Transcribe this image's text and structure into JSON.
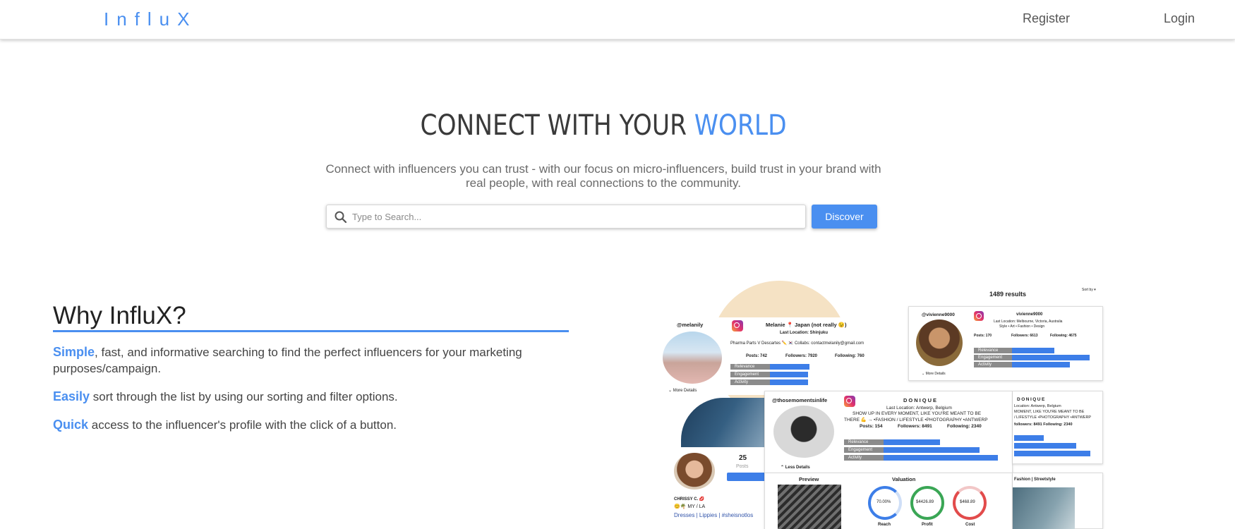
{
  "navbar": {
    "logo": "InfluX",
    "register": "Register",
    "login": "Login"
  },
  "hero": {
    "title_main": "CONNECT WITH YOUR ",
    "title_accent": "WORLD",
    "subtitle": "Connect with influencers you can trust - with our focus on micro-influencers, build trust in your brand with real people, with real connections to the community.",
    "search_placeholder": "Type to Search...",
    "discover": "Discover"
  },
  "why": {
    "title": "Why InfluX?",
    "p1_keyword": "Simple",
    "p1_text": ", fast, and informative searching to find the perfect influencers for your marketing purposes/campaign.",
    "p2_keyword": "Easily",
    "p2_text": " sort through the list by using our sorting and filter options.",
    "p3_keyword": "Quick",
    "p3_text": " access to the influencer's profile with the click of a button."
  },
  "collage": {
    "results": "1489 results",
    "sortby": "Sort by ▾",
    "card1": {
      "handle": "@melanily",
      "name": "Melanie 📍 Japan (not really 😉)",
      "location": "Last Location: Shinjuku",
      "bio": "Pharma Parts V Descartes ✏️ 🇰🇷 Collabs: contactmelanily@gmail.com",
      "posts": "Posts: 742",
      "followers": "Followers: 7920",
      "following": "Following: 760",
      "more": "⌄ More Details"
    },
    "card2": {
      "handle": "@vivienne9000",
      "name": "vivienne9000",
      "location": "Last Location: Melbourne, Victoria, Australia",
      "bio": "Style • Art • Fashion • Design",
      "posts": "Posts: 170",
      "followers": "Followers: 6613",
      "following": "Following: 4675",
      "more": "⌄ More Details"
    },
    "card3": {
      "handle": "@thosemomentsinlife",
      "name": "DONIQUE",
      "location": "Last Location: Antwerp, Belgium",
      "bio1": "SHOW UP IN EVERY MOMENT, LIKE YOU'RE MEANT TO BE",
      "bio2": "THERE 💪 → •FASHION / LIFESTYLE •PHOTOGRAPHY •ANTWERP",
      "posts": "Posts: 154",
      "followers": "Followers: 8491",
      "following": "Following: 2340",
      "less": "⌃ Less Details"
    },
    "card4": {
      "name": "DONIQUE",
      "location": "Location: Antwerp, Belgium",
      "bio": "MOMENT, LIKE YOU'RE MEANT TO BE",
      "bio2": "/ LIFESTYLE •PHOTOGRAPHY •ANTWERP",
      "stats": "followers: 8491   Following: 2340",
      "tag": "Fashion | Streetstyle"
    },
    "profile": {
      "posts_count": "25",
      "posts_label": "Posts",
      "name": "CHRISSY C. 💋",
      "loc": "😊🌴 MY / LA",
      "tags": "Dresses | Lippies | #sheisnotlos"
    },
    "bars": [
      "Relevance",
      "Engagement",
      "Activity"
    ],
    "valuation": {
      "preview": "Preview",
      "title": "Valuation",
      "reach_value": "70.00%",
      "reach": "Reach",
      "profit_value": "$4426.89",
      "profit": "Profit",
      "cost_value": "$468.89",
      "cost": "Cost"
    }
  }
}
